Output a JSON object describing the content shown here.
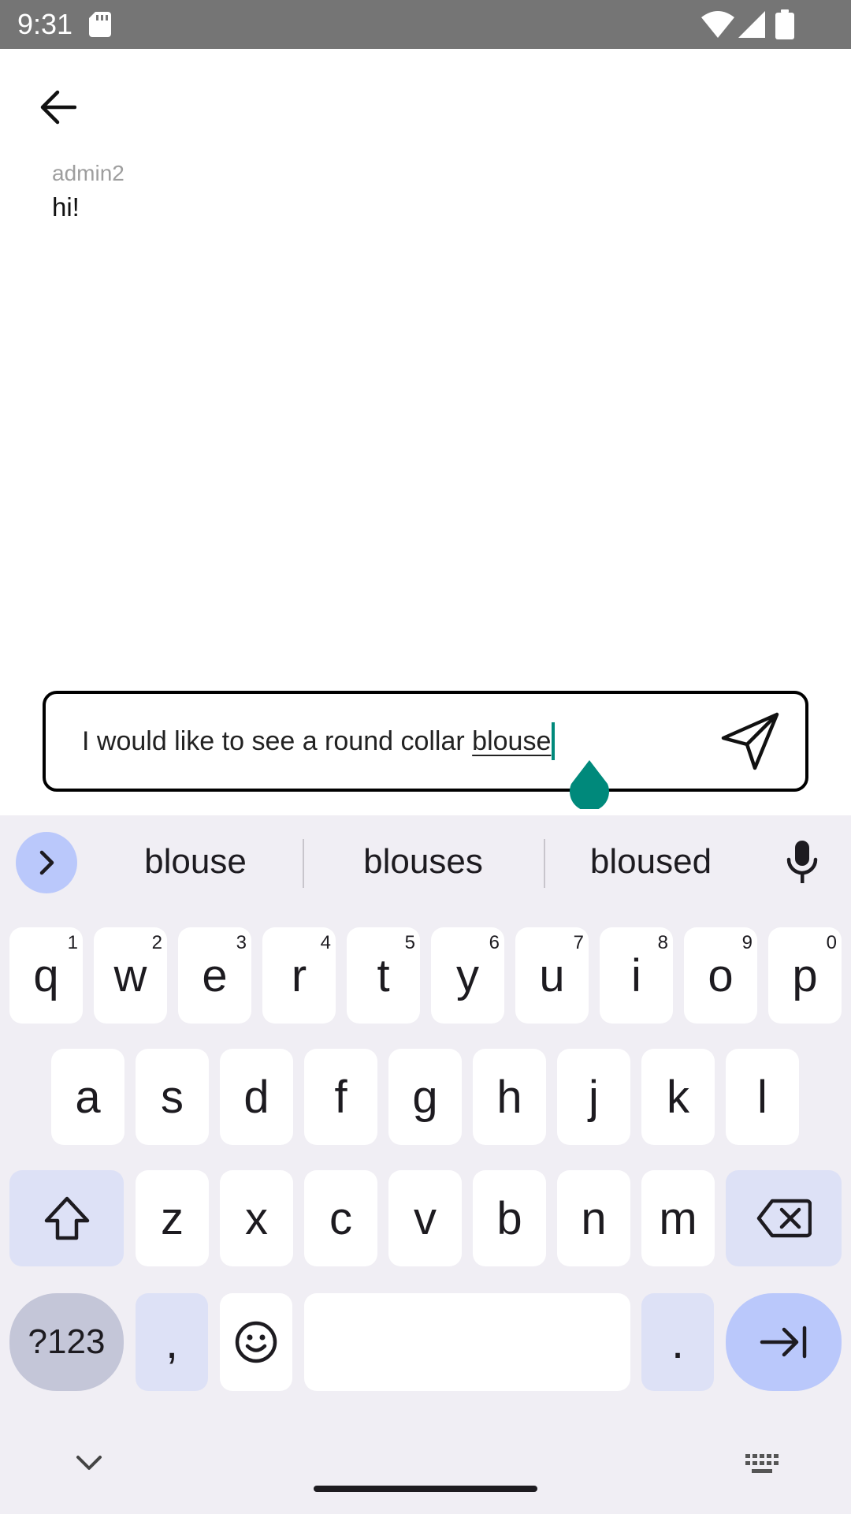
{
  "status_bar": {
    "time": "9:31"
  },
  "conversation": {
    "messages": [
      {
        "sender": "admin2",
        "text": "hi!"
      }
    ]
  },
  "composer": {
    "text_prefix": "I would like to see a round collar ",
    "text_composing": "blouse"
  },
  "keyboard": {
    "suggestions": [
      "blouse",
      "blouses",
      "bloused"
    ],
    "row1": [
      {
        "label": "q",
        "hint": "1"
      },
      {
        "label": "w",
        "hint": "2"
      },
      {
        "label": "e",
        "hint": "3"
      },
      {
        "label": "r",
        "hint": "4"
      },
      {
        "label": "t",
        "hint": "5"
      },
      {
        "label": "y",
        "hint": "6"
      },
      {
        "label": "u",
        "hint": "7"
      },
      {
        "label": "i",
        "hint": "8"
      },
      {
        "label": "o",
        "hint": "9"
      },
      {
        "label": "p",
        "hint": "0"
      }
    ],
    "row2": [
      "a",
      "s",
      "d",
      "f",
      "g",
      "h",
      "j",
      "k",
      "l"
    ],
    "row3": [
      "z",
      "x",
      "c",
      "v",
      "b",
      "n",
      "m"
    ],
    "symbols_label": "?123",
    "comma_label": ",",
    "period_label": "."
  },
  "colors": {
    "status_bar": "#757575",
    "accent_teal": "#00897b",
    "keyboard_bg": "#f0eef4",
    "key_modifier": "#dde1f6",
    "key_enter": "#bac8fb"
  }
}
